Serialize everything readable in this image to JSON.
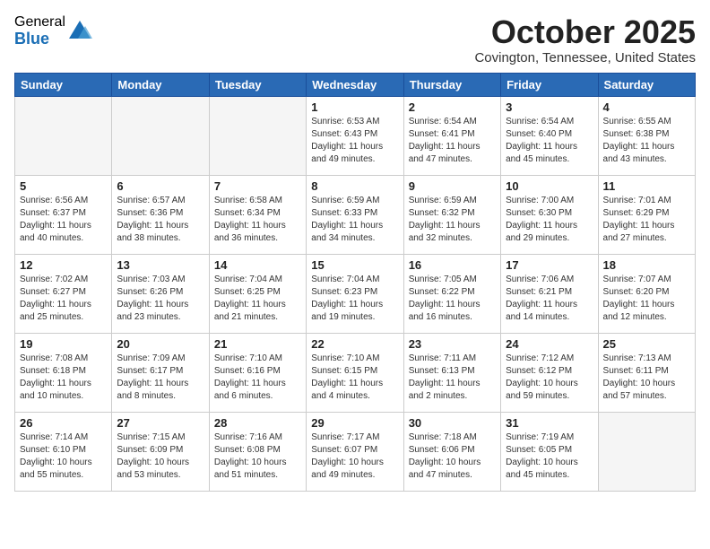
{
  "logo": {
    "general": "General",
    "blue": "Blue"
  },
  "title": "October 2025",
  "location": "Covington, Tennessee, United States",
  "days_header": [
    "Sunday",
    "Monday",
    "Tuesday",
    "Wednesday",
    "Thursday",
    "Friday",
    "Saturday"
  ],
  "weeks": [
    [
      {
        "day": "",
        "info": ""
      },
      {
        "day": "",
        "info": ""
      },
      {
        "day": "",
        "info": ""
      },
      {
        "day": "1",
        "info": "Sunrise: 6:53 AM\nSunset: 6:43 PM\nDaylight: 11 hours\nand 49 minutes."
      },
      {
        "day": "2",
        "info": "Sunrise: 6:54 AM\nSunset: 6:41 PM\nDaylight: 11 hours\nand 47 minutes."
      },
      {
        "day": "3",
        "info": "Sunrise: 6:54 AM\nSunset: 6:40 PM\nDaylight: 11 hours\nand 45 minutes."
      },
      {
        "day": "4",
        "info": "Sunrise: 6:55 AM\nSunset: 6:38 PM\nDaylight: 11 hours\nand 43 minutes."
      }
    ],
    [
      {
        "day": "5",
        "info": "Sunrise: 6:56 AM\nSunset: 6:37 PM\nDaylight: 11 hours\nand 40 minutes."
      },
      {
        "day": "6",
        "info": "Sunrise: 6:57 AM\nSunset: 6:36 PM\nDaylight: 11 hours\nand 38 minutes."
      },
      {
        "day": "7",
        "info": "Sunrise: 6:58 AM\nSunset: 6:34 PM\nDaylight: 11 hours\nand 36 minutes."
      },
      {
        "day": "8",
        "info": "Sunrise: 6:59 AM\nSunset: 6:33 PM\nDaylight: 11 hours\nand 34 minutes."
      },
      {
        "day": "9",
        "info": "Sunrise: 6:59 AM\nSunset: 6:32 PM\nDaylight: 11 hours\nand 32 minutes."
      },
      {
        "day": "10",
        "info": "Sunrise: 7:00 AM\nSunset: 6:30 PM\nDaylight: 11 hours\nand 29 minutes."
      },
      {
        "day": "11",
        "info": "Sunrise: 7:01 AM\nSunset: 6:29 PM\nDaylight: 11 hours\nand 27 minutes."
      }
    ],
    [
      {
        "day": "12",
        "info": "Sunrise: 7:02 AM\nSunset: 6:27 PM\nDaylight: 11 hours\nand 25 minutes."
      },
      {
        "day": "13",
        "info": "Sunrise: 7:03 AM\nSunset: 6:26 PM\nDaylight: 11 hours\nand 23 minutes."
      },
      {
        "day": "14",
        "info": "Sunrise: 7:04 AM\nSunset: 6:25 PM\nDaylight: 11 hours\nand 21 minutes."
      },
      {
        "day": "15",
        "info": "Sunrise: 7:04 AM\nSunset: 6:23 PM\nDaylight: 11 hours\nand 19 minutes."
      },
      {
        "day": "16",
        "info": "Sunrise: 7:05 AM\nSunset: 6:22 PM\nDaylight: 11 hours\nand 16 minutes."
      },
      {
        "day": "17",
        "info": "Sunrise: 7:06 AM\nSunset: 6:21 PM\nDaylight: 11 hours\nand 14 minutes."
      },
      {
        "day": "18",
        "info": "Sunrise: 7:07 AM\nSunset: 6:20 PM\nDaylight: 11 hours\nand 12 minutes."
      }
    ],
    [
      {
        "day": "19",
        "info": "Sunrise: 7:08 AM\nSunset: 6:18 PM\nDaylight: 11 hours\nand 10 minutes."
      },
      {
        "day": "20",
        "info": "Sunrise: 7:09 AM\nSunset: 6:17 PM\nDaylight: 11 hours\nand 8 minutes."
      },
      {
        "day": "21",
        "info": "Sunrise: 7:10 AM\nSunset: 6:16 PM\nDaylight: 11 hours\nand 6 minutes."
      },
      {
        "day": "22",
        "info": "Sunrise: 7:10 AM\nSunset: 6:15 PM\nDaylight: 11 hours\nand 4 minutes."
      },
      {
        "day": "23",
        "info": "Sunrise: 7:11 AM\nSunset: 6:13 PM\nDaylight: 11 hours\nand 2 minutes."
      },
      {
        "day": "24",
        "info": "Sunrise: 7:12 AM\nSunset: 6:12 PM\nDaylight: 10 hours\nand 59 minutes."
      },
      {
        "day": "25",
        "info": "Sunrise: 7:13 AM\nSunset: 6:11 PM\nDaylight: 10 hours\nand 57 minutes."
      }
    ],
    [
      {
        "day": "26",
        "info": "Sunrise: 7:14 AM\nSunset: 6:10 PM\nDaylight: 10 hours\nand 55 minutes."
      },
      {
        "day": "27",
        "info": "Sunrise: 7:15 AM\nSunset: 6:09 PM\nDaylight: 10 hours\nand 53 minutes."
      },
      {
        "day": "28",
        "info": "Sunrise: 7:16 AM\nSunset: 6:08 PM\nDaylight: 10 hours\nand 51 minutes."
      },
      {
        "day": "29",
        "info": "Sunrise: 7:17 AM\nSunset: 6:07 PM\nDaylight: 10 hours\nand 49 minutes."
      },
      {
        "day": "30",
        "info": "Sunrise: 7:18 AM\nSunset: 6:06 PM\nDaylight: 10 hours\nand 47 minutes."
      },
      {
        "day": "31",
        "info": "Sunrise: 7:19 AM\nSunset: 6:05 PM\nDaylight: 10 hours\nand 45 minutes."
      },
      {
        "day": "",
        "info": ""
      }
    ]
  ]
}
